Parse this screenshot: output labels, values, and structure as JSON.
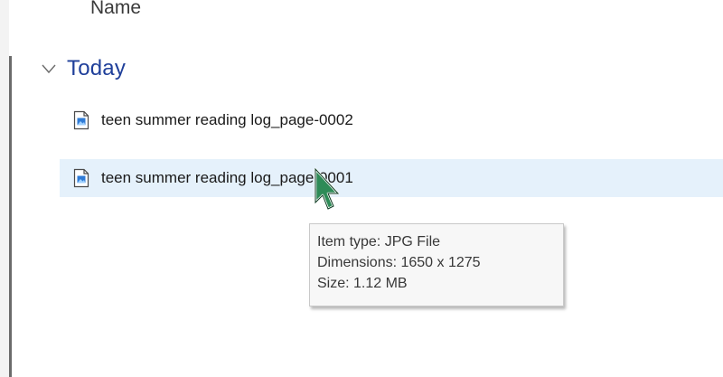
{
  "header": {
    "column_name_label": "Name"
  },
  "group": {
    "label": "Today",
    "expanded": true
  },
  "files": [
    {
      "name": "teen summer reading log_page-0002",
      "icon": "image-file-icon",
      "selected": false
    },
    {
      "name": "teen summer reading log_page-0001",
      "icon": "image-file-icon",
      "selected": true
    }
  ],
  "tooltip": {
    "item_type": "Item type: JPG File",
    "dimensions": "Dimensions: 1650 x 1275",
    "size": "Size: 1.12 MB"
  },
  "colors": {
    "group_header": "#1f3f9a",
    "selection_background": "#e5f1fb",
    "tooltip_background": "#f7f7f7",
    "cursor_fill": "#2e8b57"
  }
}
